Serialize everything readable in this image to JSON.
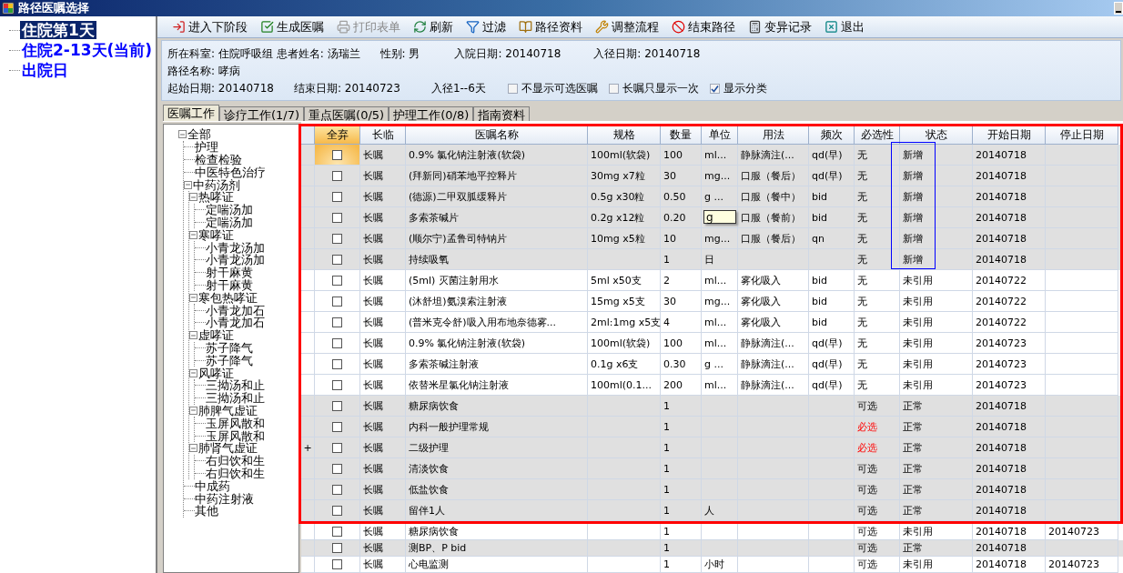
{
  "window": {
    "title": "路径医嘱选择"
  },
  "stage_tree": [
    {
      "label": "住院第1天",
      "selected": true
    },
    {
      "label": "住院2-13天(当前)",
      "selected": false
    },
    {
      "label": "出院日",
      "selected": false
    }
  ],
  "toolbar": [
    {
      "label": "进入下阶段",
      "kind": "enter",
      "disabled": false
    },
    {
      "label": "生成医嘱",
      "kind": "check",
      "disabled": false
    },
    {
      "label": "打印表单",
      "kind": "print",
      "disabled": true
    },
    {
      "label": "刷新",
      "kind": "refresh",
      "disabled": false
    },
    {
      "label": "过滤",
      "kind": "filter",
      "disabled": false
    },
    {
      "label": "路径资料",
      "kind": "book",
      "disabled": false
    },
    {
      "label": "调整流程",
      "kind": "adjust",
      "disabled": false
    },
    {
      "label": "结束路径",
      "kind": "stop",
      "disabled": false
    },
    {
      "label": "变异记录",
      "kind": "calc",
      "disabled": false
    },
    {
      "label": "退出",
      "kind": "exit",
      "disabled": false
    }
  ],
  "info": {
    "department": "所在科室: 住院呼吸组",
    "patient": "患者姓名: 汤瑞兰",
    "sex": "性别:  男",
    "admission_date": "入院日期: 20140718",
    "path_entry_date": "入径日期: 20140718",
    "path_name": "路径名称: 哮病",
    "start_date": "起始日期: 20140718",
    "end_date": "结束日期: 20140723",
    "days": "入径1--6天",
    "options": [
      {
        "label": "不显示可选医嘱",
        "checked": false
      },
      {
        "label": "长嘱只显示一次",
        "checked": false
      },
      {
        "label": "显示分类",
        "checked": true
      }
    ]
  },
  "tabs": [
    {
      "label": "医嘱工作",
      "selected": true
    },
    {
      "label": "诊疗工作(1/7)",
      "selected": false
    },
    {
      "label": "重点医嘱(0/5)",
      "selected": false
    },
    {
      "label": "护理工作(0/8)",
      "selected": false
    },
    {
      "label": "指南资料",
      "selected": false
    }
  ],
  "category_tree": [
    {
      "label": "全部",
      "expanded": true,
      "children": [
        {
          "label": "护理"
        },
        {
          "label": "检查检验"
        },
        {
          "label": "中医特色治疗"
        },
        {
          "label": "中药汤剂",
          "expanded": true,
          "children": [
            {
              "label": "热哮证",
              "expanded": true,
              "children": [
                {
                  "label": "定喘汤加"
                },
                {
                  "label": "定喘汤加"
                }
              ]
            },
            {
              "label": "寒哮证",
              "expanded": true,
              "children": [
                {
                  "label": "小青龙汤加"
                },
                {
                  "label": "小青龙汤加"
                },
                {
                  "label": "射干麻黄"
                },
                {
                  "label": "射干麻黄"
                }
              ]
            },
            {
              "label": "寒包热哮证",
              "expanded": true,
              "children": [
                {
                  "label": "小青龙加石"
                },
                {
                  "label": "小青龙加石"
                }
              ]
            },
            {
              "label": "虚哮证",
              "expanded": true,
              "children": [
                {
                  "label": "苏子降气"
                },
                {
                  "label": "苏子降气"
                }
              ]
            },
            {
              "label": "风哮证",
              "expanded": true,
              "children": [
                {
                  "label": "三拗汤和止"
                },
                {
                  "label": "三拗汤和止"
                }
              ]
            },
            {
              "label": "肺脾气虚证",
              "expanded": true,
              "children": [
                {
                  "label": "玉屏风散和"
                },
                {
                  "label": "玉屏风散和"
                }
              ]
            },
            {
              "label": "肺肾气虚证",
              "expanded": true,
              "children": [
                {
                  "label": "右归饮和生"
                },
                {
                  "label": "右归饮和生"
                }
              ]
            }
          ]
        },
        {
          "label": "中成药"
        },
        {
          "label": "中药注射液"
        },
        {
          "label": "其他"
        }
      ]
    }
  ],
  "table": {
    "columns": [
      {
        "label": "全弃",
        "selected": true
      },
      {
        "label": "长临",
        "selected": false
      },
      {
        "label": "医嘱名称",
        "selected": false
      },
      {
        "label": "规格",
        "selected": false
      },
      {
        "label": "数量",
        "selected": false
      },
      {
        "label": "单位",
        "selected": false
      },
      {
        "label": "用法",
        "selected": false
      },
      {
        "label": "频次",
        "selected": false
      },
      {
        "label": "必选性",
        "selected": false
      },
      {
        "label": "状态",
        "selected": false
      },
      {
        "label": "开始日期",
        "selected": false
      },
      {
        "label": "停止日期",
        "selected": false
      }
    ],
    "framed_rows": [
      {
        "checked": false,
        "current": true,
        "shaded": true,
        "status_boxed": true,
        "type": "长嘱",
        "name": "0.9% 氯化钠注射液(软袋)",
        "spec": "100ml(软袋)",
        "qty": "100",
        "unit": "ml...",
        "usage": "静脉滴注(...",
        "freq": "qd(早)",
        "required": "无",
        "mandatory": false,
        "status": "新增",
        "start": "20140718"
      },
      {
        "checked": false,
        "current": false,
        "shaded": true,
        "status_boxed": true,
        "type": "长嘱",
        "name": "(拜新同)硝苯地平控释片",
        "spec": "30mg x7粒",
        "qty": "30",
        "unit": "mg...",
        "usage": "口服（餐后）",
        "freq": "qd(早)",
        "required": "无",
        "mandatory": false,
        "status": "新增",
        "start": "20140718"
      },
      {
        "checked": false,
        "current": false,
        "shaded": true,
        "status_boxed": true,
        "type": "长嘱",
        "name": "(德源)二甲双胍缓释片",
        "spec": "0.5g x30粒",
        "qty": "0.50",
        "unit": "g ...",
        "usage": "口服（餐中）",
        "freq": "bid",
        "required": "无",
        "mandatory": false,
        "status": "新增",
        "start": "20140718"
      },
      {
        "checked": false,
        "current": false,
        "shaded": true,
        "status_boxed": true,
        "editing": true,
        "type": "长嘱",
        "name": "多索茶碱片",
        "spec": "0.2g x12粒",
        "qty": "0.20",
        "unit": "g",
        "usage": "口服（餐前）",
        "freq": "bid",
        "required": "无",
        "mandatory": false,
        "status": "新增",
        "start": "20140718"
      },
      {
        "checked": false,
        "current": false,
        "shaded": true,
        "status_boxed": true,
        "type": "长嘱",
        "name": "(顺尔宁)孟鲁司特钠片",
        "spec": "10mg x5粒",
        "qty": "10",
        "unit": "mg...",
        "usage": "口服（餐后）",
        "freq": "qn",
        "required": "无",
        "mandatory": false,
        "status": "新增",
        "start": "20140718"
      },
      {
        "checked": false,
        "current": false,
        "shaded": true,
        "status_boxed": true,
        "type": "长嘱",
        "name": "持续吸氧",
        "qty": "1",
        "unit": "日",
        "required": "无",
        "mandatory": false,
        "status": "新增",
        "start": "20140718"
      },
      {
        "checked": false,
        "current": false,
        "shaded": false,
        "status_boxed": false,
        "type": "长嘱",
        "name": "(5ml) 灭菌注射用水",
        "spec": "5ml x50支",
        "qty": "2",
        "unit": "ml...",
        "usage": "雾化吸入",
        "freq": "bid",
        "required": "无",
        "mandatory": false,
        "status": "未引用",
        "start": "20140722"
      },
      {
        "checked": false,
        "current": false,
        "shaded": false,
        "status_boxed": false,
        "type": "长嘱",
        "name": "(沐舒坦)氨溴索注射液",
        "spec": "15mg x5支",
        "qty": "30",
        "unit": "mg...",
        "usage": "雾化吸入",
        "freq": "bid",
        "required": "无",
        "mandatory": false,
        "status": "未引用",
        "start": "20140722"
      },
      {
        "checked": false,
        "current": false,
        "shaded": false,
        "status_boxed": false,
        "type": "长嘱",
        "name": "(普米克令舒)吸入用布地奈德雾...",
        "spec": "2ml:1mg x5支",
        "qty": "4",
        "unit": "ml...",
        "usage": "雾化吸入",
        "freq": "bid",
        "required": "无",
        "mandatory": false,
        "status": "未引用",
        "start": "20140722"
      },
      {
        "checked": false,
        "current": false,
        "shaded": false,
        "status_boxed": false,
        "type": "长嘱",
        "name": "0.9% 氯化钠注射液(软袋)",
        "spec": "100ml(软袋)",
        "qty": "100",
        "unit": "ml...",
        "usage": "静脉滴注(...",
        "freq": "qd(早)",
        "required": "无",
        "mandatory": false,
        "status": "未引用",
        "start": "20140723"
      },
      {
        "checked": false,
        "current": false,
        "shaded": false,
        "status_boxed": false,
        "type": "长嘱",
        "name": "多索茶碱注射液",
        "spec": "0.1g x6支",
        "qty": "0.30",
        "unit": "g ...",
        "usage": "静脉滴注(...",
        "freq": "qd(早)",
        "required": "无",
        "mandatory": false,
        "status": "未引用",
        "start": "20140723"
      },
      {
        "checked": false,
        "current": false,
        "shaded": false,
        "status_boxed": false,
        "type": "长嘱",
        "name": "依替米星氯化钠注射液",
        "spec": "100ml(0.1...",
        "qty": "200",
        "unit": "ml...",
        "usage": "静脉滴注(...",
        "freq": "qd(早)",
        "required": "无",
        "mandatory": false,
        "status": "未引用",
        "start": "20140723"
      },
      {
        "checked": false,
        "current": false,
        "shaded": true,
        "status_boxed": false,
        "type": "长嘱",
        "name": "糖尿病饮食",
        "qty": "1",
        "required": "可选",
        "mandatory": false,
        "status": "正常",
        "start": "20140718"
      },
      {
        "checked": false,
        "current": false,
        "shaded": true,
        "status_boxed": false,
        "type": "长嘱",
        "name": "内科一般护理常规",
        "qty": "1",
        "required": "必选",
        "mandatory": true,
        "status": "正常",
        "start": "20140718"
      },
      {
        "checked": false,
        "current": false,
        "shaded": true,
        "status_boxed": false,
        "marker": "+",
        "type": "长嘱",
        "name": "二级护理",
        "qty": "1",
        "required": "必选",
        "mandatory": true,
        "status": "正常",
        "start": "20140718"
      },
      {
        "checked": false,
        "current": false,
        "shaded": true,
        "status_boxed": false,
        "type": "长嘱",
        "name": "清淡饮食",
        "qty": "1",
        "required": "可选",
        "mandatory": false,
        "status": "正常",
        "start": "20140718"
      },
      {
        "checked": false,
        "current": false,
        "shaded": true,
        "status_boxed": false,
        "type": "长嘱",
        "name": "低盐饮食",
        "qty": "1",
        "required": "可选",
        "mandatory": false,
        "status": "正常",
        "start": "20140718"
      },
      {
        "checked": false,
        "current": false,
        "shaded": true,
        "status_boxed": false,
        "type": "长嘱",
        "name": "留伴1人",
        "qty": "1",
        "unit": "人",
        "required": "可选",
        "mandatory": false,
        "status": "正常",
        "start": "20140718"
      }
    ],
    "rows": [
      {
        "checked": false,
        "current": false,
        "shaded": false,
        "status_boxed": false,
        "type": "长嘱",
        "name": "糖尿病饮食",
        "qty": "1",
        "required": "可选",
        "mandatory": false,
        "status": "未引用",
        "start": "20140718",
        "stop": "20140723"
      },
      {
        "checked": false,
        "current": false,
        "shaded": true,
        "status_boxed": false,
        "type": "长嘱",
        "name": "测BP、P bid",
        "qty": "1",
        "required": "可选",
        "mandatory": false,
        "status": "正常",
        "start": "20140718"
      },
      {
        "checked": false,
        "current": false,
        "shaded": false,
        "status_boxed": false,
        "type": "长嘱",
        "name": "心电监测",
        "qty": "1",
        "unit": "小时",
        "required": "可选",
        "mandatory": false,
        "status": "未引用",
        "start": "20140718",
        "stop": "20140723"
      }
    ]
  }
}
